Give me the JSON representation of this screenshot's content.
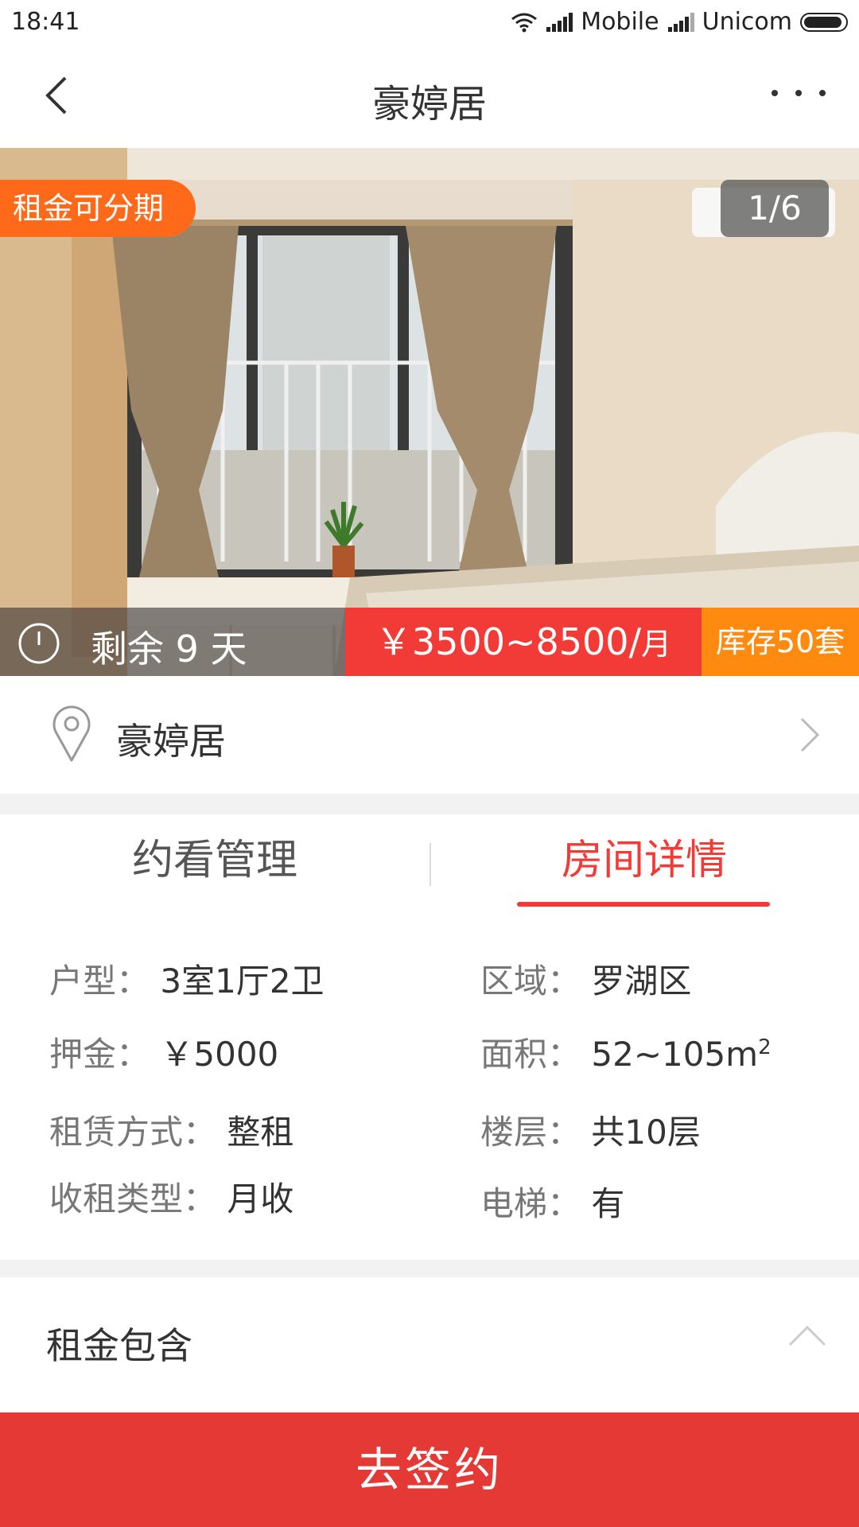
{
  "status_bar": {
    "time": "18:41",
    "carrier1": "Mobile",
    "carrier2": "Unicom"
  },
  "nav": {
    "title": "豪婷居",
    "back_icon": "chevron-left-icon",
    "more_icon": "more-horizontal-icon"
  },
  "hero": {
    "installment_badge": "租金可分期",
    "photo_counter": "1/6",
    "countdown": "剩余 9 天",
    "price": "￥3500~8500/",
    "price_unit": "月",
    "stock": "库存50套"
  },
  "location": {
    "name": "豪婷居"
  },
  "tabs": [
    {
      "label": "约看管理",
      "active": false
    },
    {
      "label": "房间详情",
      "active": true
    }
  ],
  "details": {
    "layout_label": "户型：",
    "layout_value": "3室1厅2卫",
    "district_label": "区域：",
    "district_value": "罗湖区",
    "deposit_label": "押金：",
    "deposit_value": "￥5000",
    "area_label": "面积：",
    "area_value": "52~105m",
    "area_sup": "2",
    "lease_label": "租赁方式：",
    "lease_value": "整租",
    "floor_label": "楼层：",
    "floor_value": "共10层",
    "rent_type_label": "收租类型：",
    "rent_type_value": "月收",
    "elevator_label": "电梯：",
    "elevator_value": "有"
  },
  "rent_includes": {
    "title": "租金包含"
  },
  "action": {
    "sign_label": "去签约"
  },
  "colors": {
    "accent_red": "#f23a36",
    "button_red": "#e53935",
    "orange": "#ff6a1a",
    "stock_orange": "#ff8a10"
  }
}
